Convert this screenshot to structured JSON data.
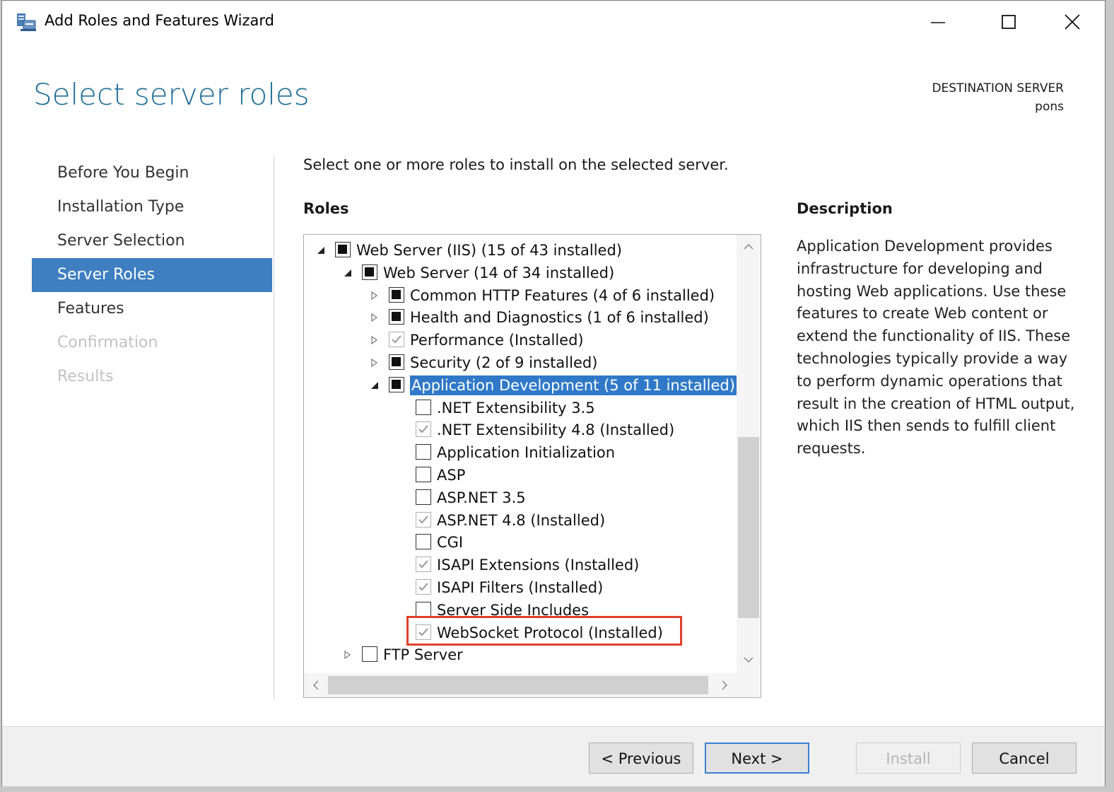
{
  "window": {
    "title": "Add Roles and Features Wizard"
  },
  "header": {
    "page_title": "Select server roles",
    "destination_label": "DESTINATION SERVER",
    "destination_value": "pons"
  },
  "nav": {
    "items": [
      {
        "label": "Before You Begin",
        "state": "normal"
      },
      {
        "label": "Installation Type",
        "state": "normal"
      },
      {
        "label": "Server Selection",
        "state": "normal"
      },
      {
        "label": "Server Roles",
        "state": "active"
      },
      {
        "label": "Features",
        "state": "normal"
      },
      {
        "label": "Confirmation",
        "state": "disabled"
      },
      {
        "label": "Results",
        "state": "disabled"
      }
    ]
  },
  "main": {
    "instruction": "Select one or more roles to install on the selected server.",
    "roles_label": "Roles",
    "tree": [
      {
        "label": "Web Server (IIS) (15 of 43 installed)",
        "check": "partial",
        "expand": "expanded"
      },
      {
        "label": "Web Server (14 of 34 installed)",
        "check": "partial",
        "expand": "expanded"
      },
      {
        "label": "Common HTTP Features (4 of 6 installed)",
        "check": "partial",
        "expand": "collapsed"
      },
      {
        "label": "Health and Diagnostics (1 of 6 installed)",
        "check": "partial",
        "expand": "collapsed"
      },
      {
        "label": "Performance (Installed)",
        "check": "checked",
        "expand": "collapsed"
      },
      {
        "label": "Security (2 of 9 installed)",
        "check": "partial",
        "expand": "collapsed"
      },
      {
        "label": "Application Development (5 of 11 installed)",
        "check": "partial",
        "expand": "expanded",
        "selected": true
      },
      {
        "label": ".NET Extensibility 3.5",
        "check": "unchecked",
        "expand": "none"
      },
      {
        "label": ".NET Extensibility 4.8 (Installed)",
        "check": "checked",
        "expand": "none"
      },
      {
        "label": "Application Initialization",
        "check": "unchecked",
        "expand": "none"
      },
      {
        "label": "ASP",
        "check": "unchecked",
        "expand": "none"
      },
      {
        "label": "ASP.NET 3.5",
        "check": "unchecked",
        "expand": "none"
      },
      {
        "label": "ASP.NET 4.8 (Installed)",
        "check": "checked",
        "expand": "none"
      },
      {
        "label": "CGI",
        "check": "unchecked",
        "expand": "none"
      },
      {
        "label": "ISAPI Extensions (Installed)",
        "check": "checked",
        "expand": "none"
      },
      {
        "label": "ISAPI Filters (Installed)",
        "check": "checked",
        "expand": "none"
      },
      {
        "label": "Server Side Includes",
        "check": "unchecked",
        "expand": "none"
      },
      {
        "label": "WebSocket Protocol (Installed)",
        "check": "checked",
        "expand": "none",
        "highlighted": true
      },
      {
        "label": "FTP Server",
        "check": "unchecked",
        "expand": "collapsed"
      }
    ]
  },
  "description": {
    "label": "Description",
    "text": "Application Development provides infrastructure for developing and hosting Web applications. Use these features to create Web content or extend the functionality of IIS. These technologies typically provide a way to perform dynamic operations that result in the creation of HTML output, which IIS then sends to fulfill client requests."
  },
  "footer": {
    "previous_label": "< Previous",
    "next_label": "Next >",
    "install_label": "Install",
    "cancel_label": "Cancel"
  },
  "colors": {
    "accent": "#3e7fc1",
    "heading": "#1e6e97",
    "selection": "#3079c8",
    "highlight_box": "#e0402a"
  }
}
